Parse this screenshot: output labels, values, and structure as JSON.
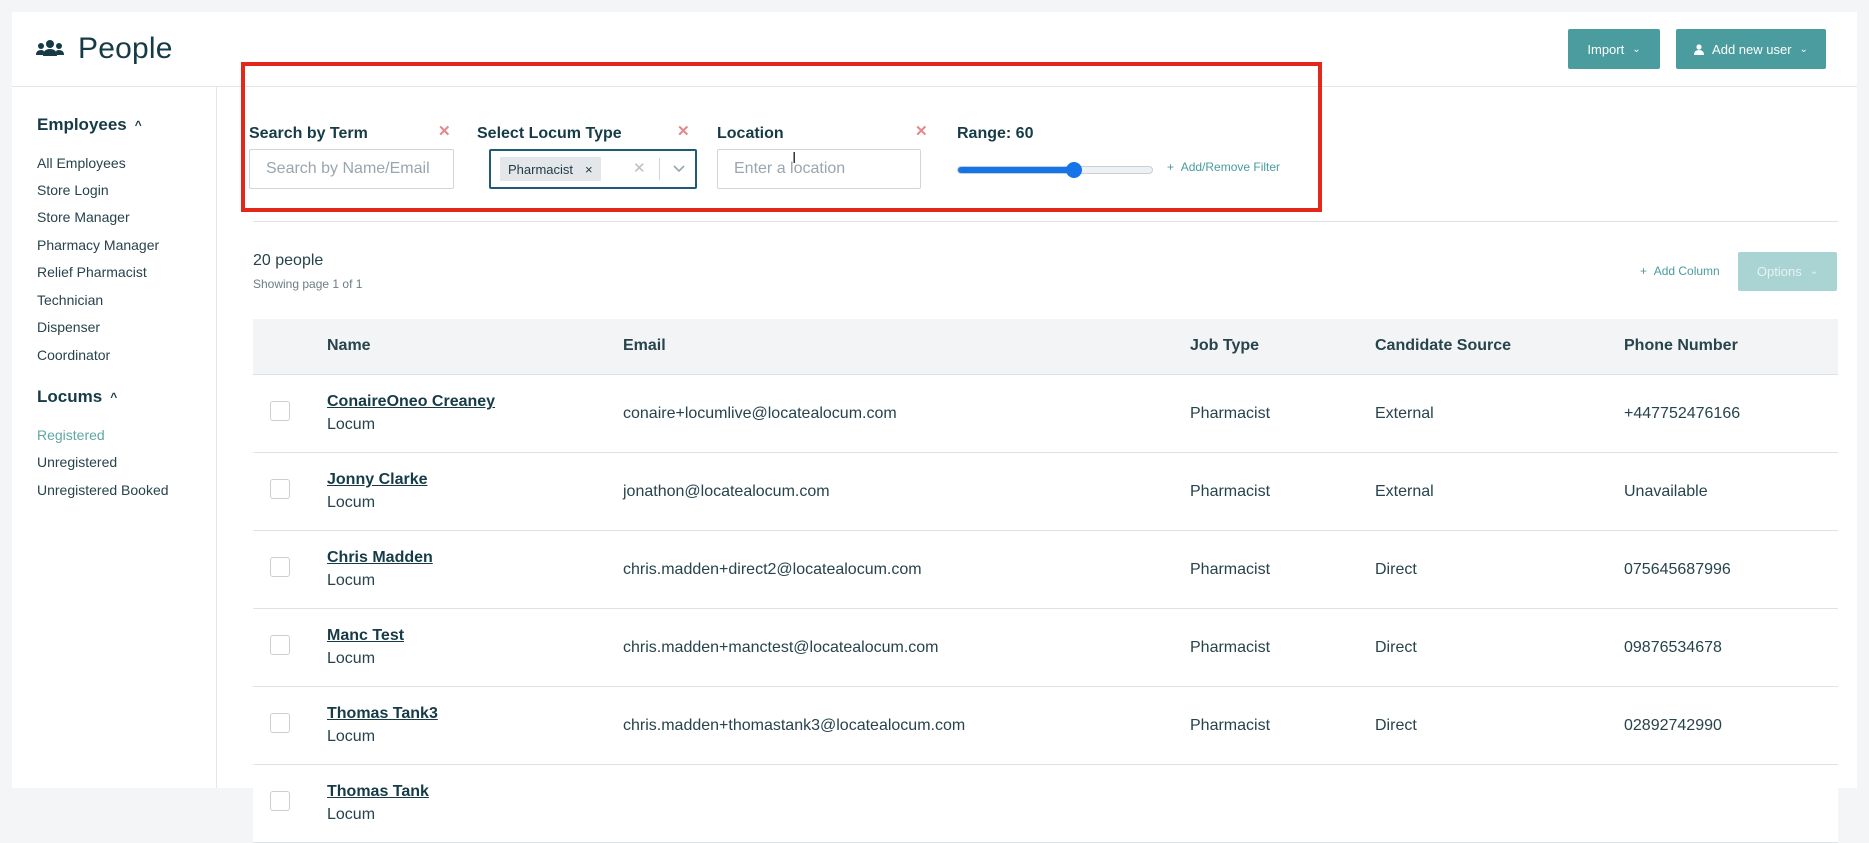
{
  "header": {
    "title": "People",
    "import_label": "Import",
    "add_user_label": "Add new user"
  },
  "sidebar": {
    "employees_heading": "Employees",
    "employees": [
      "All Employees",
      "Store Login",
      "Store Manager",
      "Pharmacy Manager",
      "Relief Pharmacist",
      "Technician",
      "Dispenser",
      "Coordinator"
    ],
    "locums_heading": "Locums",
    "locums": [
      "Registered",
      "Unregistered",
      "Unregistered Booked"
    ],
    "active_item": "Registered"
  },
  "filters": {
    "search_label": "Search by Term",
    "search_placeholder": "Search by Name/Email",
    "locum_type_label": "Select Locum Type",
    "locum_type_chip": "Pharmacist",
    "location_label": "Location",
    "location_placeholder": "Enter a location",
    "range_label": "Range: 60",
    "range_value": 60,
    "range_max": 100,
    "add_remove_label": "Add/Remove Filter"
  },
  "results": {
    "count_label": "20 people",
    "page_info": "Showing page 1 of 1",
    "add_column_label": "Add Column",
    "options_label": "Options"
  },
  "table": {
    "columns": [
      "Name",
      "Email",
      "Job Type",
      "Candidate Source",
      "Phone Number"
    ],
    "rows": [
      {
        "name": "ConaireOneo Creaney",
        "type": "Locum",
        "email": "conaire+locumlive@locatealocum.com",
        "job": "Pharmacist",
        "source": "External",
        "phone": "+447752476166"
      },
      {
        "name": "Jonny Clarke",
        "type": "Locum",
        "email": "jonathon@locatealocum.com",
        "job": "Pharmacist",
        "source": "External",
        "phone": "Unavailable"
      },
      {
        "name": "Chris Madden",
        "type": "Locum",
        "email": "chris.madden+direct2@locatealocum.com",
        "job": "Pharmacist",
        "source": "Direct",
        "phone": "075645687996"
      },
      {
        "name": "Manc Test",
        "type": "Locum",
        "email": "chris.madden+manctest@locatealocum.com",
        "job": "Pharmacist",
        "source": "Direct",
        "phone": "09876534678"
      },
      {
        "name": "Thomas Tank3",
        "type": "Locum",
        "email": "chris.madden+thomastank3@locatealocum.com",
        "job": "Pharmacist",
        "source": "Direct",
        "phone": "02892742990"
      },
      {
        "name": "Thomas Tank",
        "type": "Locum",
        "email": "",
        "job": "",
        "source": "",
        "phone": ""
      }
    ]
  }
}
